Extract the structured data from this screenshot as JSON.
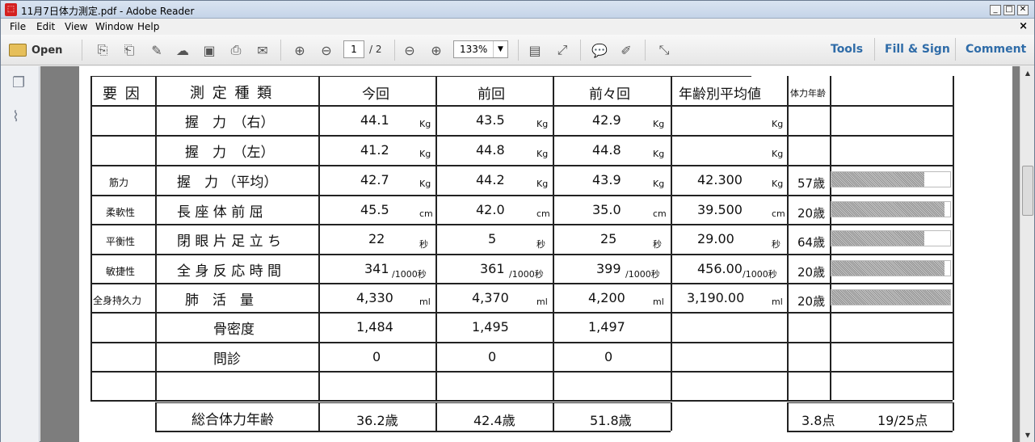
{
  "window": {
    "title": "11月7日体力測定.pdf - Adobe Reader",
    "app_icon": "pdf-icon"
  },
  "menu": [
    "File",
    "Edit",
    "View",
    "Window",
    "Help"
  ],
  "toolbar": {
    "open_label": "Open",
    "page_current": "1",
    "page_total": "/ 2",
    "zoom": "133%",
    "tools_label": "Tools",
    "fill_sign_label": "Fill & Sign",
    "comment_label": "Comment"
  },
  "doc": {
    "headers": [
      "要 因",
      "測 定 種 類",
      "今回",
      "前回",
      "前々回",
      "年齢別平均値",
      "体力年齢"
    ],
    "rows": [
      {
        "factor": "",
        "name": "握　力　（右）",
        "cur": "44.1",
        "prev": "43.5",
        "prev2": "42.9",
        "unit": "Kg",
        "avg": "",
        "avg_unit": "Kg",
        "age": ""
      },
      {
        "factor": "",
        "name": "握　力　（左）",
        "cur": "41.2",
        "prev": "44.8",
        "prev2": "44.8",
        "unit": "Kg",
        "avg": "",
        "avg_unit": "Kg",
        "age": ""
      },
      {
        "factor": "筋力",
        "name": "握　力 （平均）",
        "cur": "42.7",
        "prev": "44.2",
        "prev2": "43.9",
        "unit": "Kg",
        "avg": "42.300",
        "avg_unit": "Kg",
        "age": "57歳"
      },
      {
        "factor": "柔軟性",
        "name": "長 座 体 前 屈",
        "cur": "45.5",
        "prev": "42.0",
        "prev2": "35.0",
        "unit": "cm",
        "avg": "39.500",
        "avg_unit": "cm",
        "age": "20歳"
      },
      {
        "factor": "平衡性",
        "name": "閉 眼 片 足 立 ち",
        "cur": "22",
        "prev": "5",
        "prev2": "25",
        "unit": "秒",
        "avg": "29.00",
        "avg_unit": "秒",
        "age": "64歳"
      },
      {
        "factor": "敏捷性",
        "name": "全 身 反 応 時 間",
        "cur": "341",
        "prev": "361",
        "prev2": "399",
        "unit": "/1000秒",
        "avg": "456.00",
        "avg_unit": "/1000秒",
        "age": "20歳"
      },
      {
        "factor": "全身持久力",
        "name": "肺　活　量",
        "cur": "4,330",
        "prev": "4,370",
        "prev2": "4,200",
        "unit": "ml",
        "avg": "3,190.00",
        "avg_unit": "ml",
        "age": "20歳"
      },
      {
        "factor": "",
        "name": "骨密度",
        "cur": "1,484",
        "prev": "1,495",
        "prev2": "1,497",
        "unit": "",
        "avg": "",
        "avg_unit": "",
        "age": ""
      },
      {
        "factor": "",
        "name": "問診",
        "cur": "0",
        "prev": "0",
        "prev2": "0",
        "unit": "",
        "avg": "",
        "avg_unit": "",
        "age": ""
      }
    ],
    "bars": [
      0.78,
      0.95,
      0.78,
      0.95,
      1.0
    ],
    "summary": {
      "label": "総合体力年齢",
      "cur": "36.2歳",
      "prev": "42.4歳",
      "prev2": "51.8歳",
      "score": "3.8点",
      "points": "19/25点"
    }
  }
}
